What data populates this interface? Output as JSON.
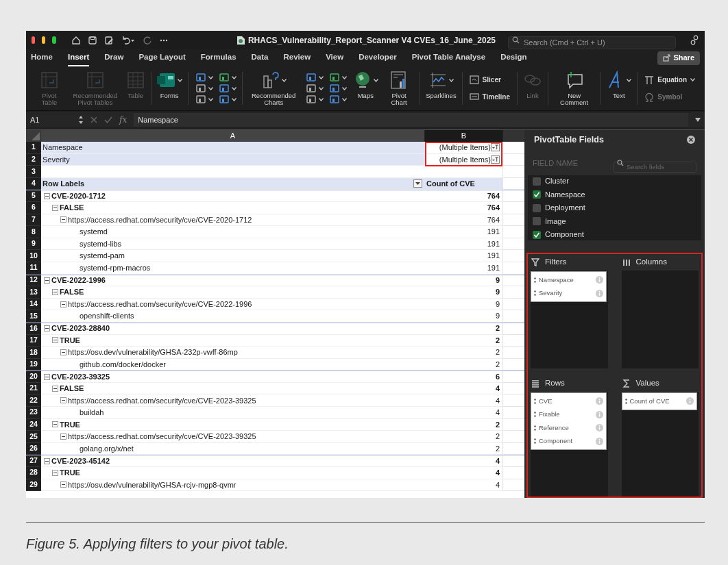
{
  "window": {
    "title": "RHACS_Vulnerability_Report_Scanner V4 CVEs_16_June_2025",
    "search_placeholder": "Search (Cmd + Ctrl + U)"
  },
  "tabs": [
    {
      "label": "Home",
      "selected": false
    },
    {
      "label": "Insert",
      "selected": true
    },
    {
      "label": "Draw",
      "selected": false
    },
    {
      "label": "Page Layout",
      "selected": false
    },
    {
      "label": "Formulas",
      "selected": false
    },
    {
      "label": "Data",
      "selected": false
    },
    {
      "label": "Review",
      "selected": false
    },
    {
      "label": "View",
      "selected": false
    },
    {
      "label": "Developer",
      "selected": false
    },
    {
      "label": "Pivot Table Analyse",
      "selected": false
    },
    {
      "label": "Design",
      "selected": false
    }
  ],
  "share_button": "Share",
  "ribbon": [
    [
      {
        "kind": "large",
        "label": "Pivot Table",
        "disabled": true,
        "dropdown": false
      },
      {
        "kind": "large",
        "label": "Recommended Pivot Tables",
        "disabled": true,
        "dropdown": false
      },
      {
        "kind": "large",
        "label": "Table",
        "disabled": true,
        "dropdown": false
      }
    ],
    [
      {
        "kind": "large",
        "label": "Forms",
        "disabled": false,
        "dropdown": true
      }
    ],
    [
      {
        "kind": "icons"
      }
    ],
    [
      {
        "kind": "large",
        "label": "Recommended Charts",
        "disabled": false,
        "dropdown": true
      },
      {
        "kind": "icons"
      },
      {
        "kind": "large",
        "label": "Maps",
        "disabled": false,
        "dropdown": true
      },
      {
        "kind": "large",
        "label": "Pivot Chart",
        "disabled": false,
        "dropdown": false
      }
    ],
    [
      {
        "kind": "large",
        "label": "Sparklines",
        "disabled": false,
        "dropdown": true
      }
    ],
    [
      {
        "kind": "stack",
        "items": [
          {
            "label": "Slicer",
            "disabled": false,
            "dropdown": false
          },
          {
            "label": "Timeline",
            "disabled": false,
            "dropdown": false
          }
        ]
      }
    ],
    [
      {
        "kind": "large",
        "label": "Link",
        "disabled": true,
        "dropdown": false
      }
    ],
    [
      {
        "kind": "large",
        "label": "New Comment",
        "disabled": false,
        "dropdown": false
      }
    ],
    [
      {
        "kind": "large",
        "label": "Text",
        "disabled": false,
        "dropdown": true
      }
    ],
    [
      {
        "kind": "stack",
        "items": [
          {
            "label": "Equation",
            "disabled": false,
            "dropdown": true
          },
          {
            "label": "Symbol",
            "disabled": true,
            "dropdown": false
          }
        ]
      }
    ]
  ],
  "formula_bar": {
    "cell": "A1",
    "function_label": "fx",
    "value": "Namespace"
  },
  "grid": {
    "columns": [
      "A",
      "B"
    ],
    "filter_highlight": true,
    "rows": [
      {
        "num": "1",
        "kind": "filter",
        "a": "Namespace",
        "b": "(Multiple Items)"
      },
      {
        "num": "2",
        "kind": "filter",
        "a": "Severity",
        "b": "(Multiple Items)"
      },
      {
        "num": "3",
        "kind": "blank"
      },
      {
        "num": "4",
        "kind": "header",
        "a": "Row Labels",
        "b": "Count of CVE"
      },
      {
        "num": "5",
        "kind": "cve",
        "a": "CVE-2020-1712",
        "b": "764"
      },
      {
        "num": "6",
        "kind": "fixable",
        "a": "FALSE",
        "b": "764"
      },
      {
        "num": "7",
        "kind": "reference",
        "a": "https://access.redhat.com/security/cve/CVE-2020-1712",
        "b": "764"
      },
      {
        "num": "8",
        "kind": "component",
        "a": "systemd",
        "b": "191"
      },
      {
        "num": "9",
        "kind": "component",
        "a": "systemd-libs",
        "b": "191"
      },
      {
        "num": "10",
        "kind": "component",
        "a": "systemd-pam",
        "b": "191"
      },
      {
        "num": "11",
        "kind": "component",
        "a": "systemd-rpm-macros",
        "b": "191"
      },
      {
        "num": "12",
        "kind": "cve",
        "a": "CVE-2022-1996",
        "b": "9"
      },
      {
        "num": "13",
        "kind": "fixable",
        "a": "FALSE",
        "b": "9"
      },
      {
        "num": "14",
        "kind": "reference",
        "a": "https://access.redhat.com/security/cve/CVE-2022-1996",
        "b": "9"
      },
      {
        "num": "15",
        "kind": "component",
        "a": "openshift-clients",
        "b": "9"
      },
      {
        "num": "16",
        "kind": "cve",
        "a": "CVE-2023-28840",
        "b": "2"
      },
      {
        "num": "17",
        "kind": "fixable",
        "a": "TRUE",
        "b": "2"
      },
      {
        "num": "18",
        "kind": "reference",
        "a": "https://osv.dev/vulnerability/GHSA-232p-vwff-86mp",
        "b": "2"
      },
      {
        "num": "19",
        "kind": "component",
        "a": "github.com/docker/docker",
        "b": "2"
      },
      {
        "num": "20",
        "kind": "cve",
        "a": "CVE-2023-39325",
        "b": "6"
      },
      {
        "num": "21",
        "kind": "fixable",
        "a": "FALSE",
        "b": "4"
      },
      {
        "num": "22",
        "kind": "reference",
        "a": "https://access.redhat.com/security/cve/CVE-2023-39325",
        "b": "4"
      },
      {
        "num": "23",
        "kind": "component",
        "a": "buildah",
        "b": "4"
      },
      {
        "num": "24",
        "kind": "fixable",
        "a": "TRUE",
        "b": "2"
      },
      {
        "num": "25",
        "kind": "reference",
        "a": "https://access.redhat.com/security/cve/CVE-2023-39325",
        "b": "2"
      },
      {
        "num": "26",
        "kind": "component",
        "a": "golang.org/x/net",
        "b": "2"
      },
      {
        "num": "27",
        "kind": "cve",
        "a": "CVE-2023-45142",
        "b": "4"
      },
      {
        "num": "28",
        "kind": "fixable",
        "a": "TRUE",
        "b": "4"
      },
      {
        "num": "29",
        "kind": "reference",
        "a": "https://osv.dev/vulnerability/GHSA-rcjv-mgp8-qvmr",
        "b": "4"
      }
    ]
  },
  "pane": {
    "title": "PivotTable Fields",
    "field_name_label": "FIELD NAME",
    "search_placeholder": "Search fields",
    "fields": [
      {
        "label": "Cluster",
        "checked": false
      },
      {
        "label": "Namespace",
        "checked": true
      },
      {
        "label": "Deployment",
        "checked": false
      },
      {
        "label": "Image",
        "checked": false
      },
      {
        "label": "Component",
        "checked": true
      }
    ],
    "areas_highlight": true,
    "filters": {
      "title": "Filters",
      "items": [
        "Namespace",
        "Sevarity"
      ]
    },
    "columns": {
      "title": "Columns"
    },
    "rows": {
      "title": "Rows",
      "items": [
        "CVE",
        "Fixable",
        "Reference",
        "Component"
      ]
    },
    "values": {
      "title": "Values",
      "items": [
        "Count of CVE"
      ]
    }
  },
  "caption": "Figure 5. Applying filters to your pivot table."
}
